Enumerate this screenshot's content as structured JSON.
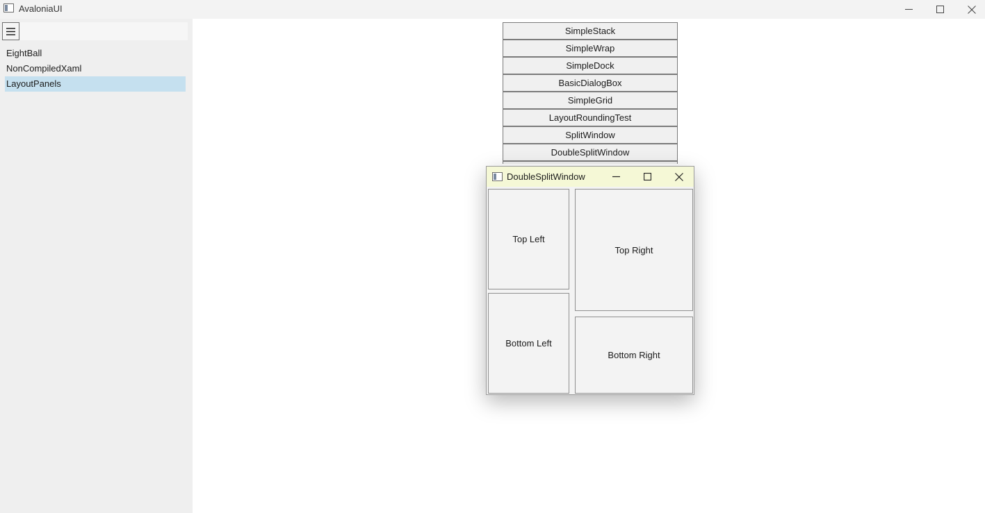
{
  "window": {
    "title": "AvaloniaUI"
  },
  "sidebar": {
    "items": [
      {
        "label": "EightBall"
      },
      {
        "label": "NonCompiledXaml"
      },
      {
        "label": "LayoutPanels"
      }
    ],
    "selected_index": 2
  },
  "samples": {
    "buttons": [
      {
        "label": "SimpleStack"
      },
      {
        "label": "SimpleWrap"
      },
      {
        "label": "SimpleDock"
      },
      {
        "label": "BasicDialogBox"
      },
      {
        "label": "SimpleGrid"
      },
      {
        "label": "LayoutRoundingTest"
      },
      {
        "label": "SplitWindow"
      },
      {
        "label": "DoubleSplitWindow"
      }
    ]
  },
  "child_window": {
    "title": "DoubleSplitWindow",
    "panes": {
      "top_left": "Top Left",
      "top_right": "Top Right",
      "bottom_left": "Bottom Left",
      "bottom_right": "Bottom Right"
    }
  },
  "colors": {
    "selected_item": "#c5e0ef",
    "child_titlebar": "#f5f8d6",
    "sidebar_bg": "#efefef"
  }
}
